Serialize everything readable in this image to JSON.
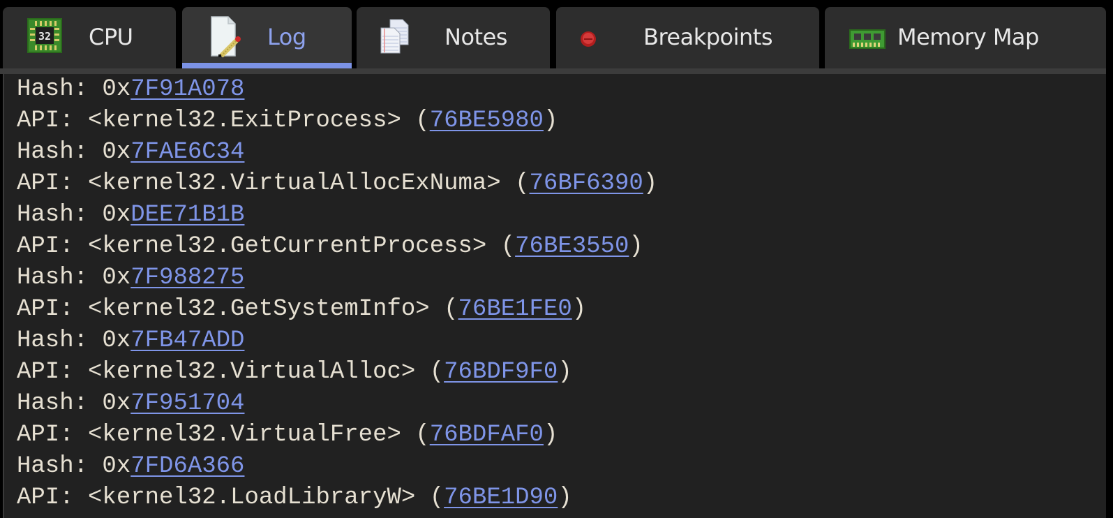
{
  "tabs": [
    {
      "id": "cpu",
      "label": "CPU",
      "icon": "cpu-chip-icon",
      "active": false
    },
    {
      "id": "log",
      "label": "Log",
      "icon": "log-document-icon",
      "active": true
    },
    {
      "id": "notes",
      "label": "Notes",
      "icon": "notes-pages-icon",
      "active": false
    },
    {
      "id": "breakpoints",
      "label": "Breakpoints",
      "icon": "breakpoint-dot-icon",
      "active": false
    },
    {
      "id": "memory_map",
      "label": "Memory Map",
      "icon": "memory-module-icon",
      "active": false
    }
  ],
  "colors": {
    "accent": "#7c93e6",
    "link": "#7f95e8",
    "text": "#e6e0d2",
    "panel_bg": "#212121",
    "tab_bg": "#2d2d2d",
    "tab_active_bg": "#363636"
  },
  "log": {
    "lines": [
      {
        "type": "hash",
        "prefix": "Hash: 0x",
        "value": "7F91A078"
      },
      {
        "type": "api",
        "prefix": "API: <kernel32.ExitProcess> (",
        "value": "76BE5980",
        "suffix": ")"
      },
      {
        "type": "hash",
        "prefix": "Hash: 0x",
        "value": "7FAE6C34"
      },
      {
        "type": "api",
        "prefix": "API: <kernel32.VirtualAllocExNuma> (",
        "value": "76BF6390",
        "suffix": ")"
      },
      {
        "type": "hash",
        "prefix": "Hash: 0x",
        "value": "DEE71B1B"
      },
      {
        "type": "api",
        "prefix": "API: <kernel32.GetCurrentProcess> (",
        "value": "76BE3550",
        "suffix": ")"
      },
      {
        "type": "hash",
        "prefix": "Hash: 0x",
        "value": "7F988275"
      },
      {
        "type": "api",
        "prefix": "API: <kernel32.GetSystemInfo> (",
        "value": "76BE1FE0",
        "suffix": ")"
      },
      {
        "type": "hash",
        "prefix": "Hash: 0x",
        "value": "7FB47ADD"
      },
      {
        "type": "api",
        "prefix": "API: <kernel32.VirtualAlloc> (",
        "value": "76BDF9F0",
        "suffix": ")"
      },
      {
        "type": "hash",
        "prefix": "Hash: 0x",
        "value": "7F951704"
      },
      {
        "type": "api",
        "prefix": "API: <kernel32.VirtualFree> (",
        "value": "76BDFAF0",
        "suffix": ")"
      },
      {
        "type": "hash",
        "prefix": "Hash: 0x",
        "value": "7FD6A366"
      },
      {
        "type": "api",
        "prefix": "API: <kernel32.LoadLibraryW> (",
        "value": "76BE1D90",
        "suffix": ")"
      }
    ]
  }
}
